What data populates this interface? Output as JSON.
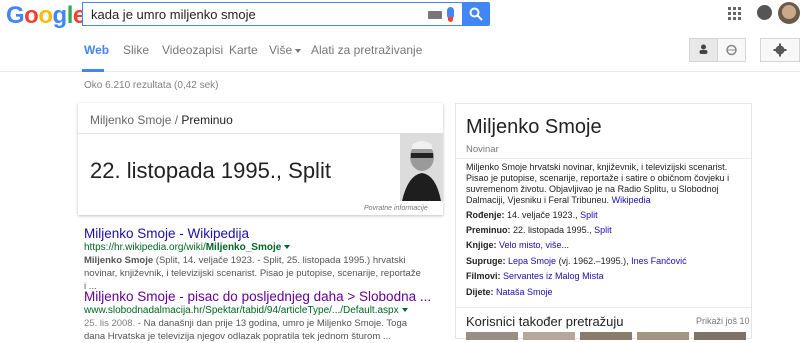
{
  "header": {
    "logo": [
      "G",
      "o",
      "o",
      "g",
      "l",
      "e"
    ],
    "logo_colors": [
      "#4285f4",
      "#ea4335",
      "#fbbc05",
      "#4285f4",
      "#34a853",
      "#ea4335"
    ],
    "query": "kada je umro miljenko smoje"
  },
  "tabs": [
    {
      "label": "Web",
      "active": true
    },
    {
      "label": "Slike"
    },
    {
      "label": "Videozapisi"
    },
    {
      "label": "Karte"
    },
    {
      "label": "Više"
    },
    {
      "label": "Alati za pretraživanje"
    }
  ],
  "stats": "Oko 6.210 rezultata (0,42 sek)",
  "answer": {
    "entity": "Miljenko Smoje",
    "separator": "/",
    "attribute": "Preminuo",
    "value": "22. listopada 1995., Split",
    "feedback": "Povratne informacije"
  },
  "results": [
    {
      "title": "Miljenko Smoje - Wikipedija",
      "url_prefix": "https://hr.wikipedia.org/wiki/",
      "url_bold": "Miljenko_Smoje",
      "snippet_bold": "Miljenko Smoje",
      "snippet": " (Split, 14. veljače 1923. - Split, 25. listopada 1995.) hrvatski novinar, književnik, i televizijski scenarist. Pisao je putopise, scenarije, reportaže i ..."
    },
    {
      "title": "Miljenko Smoje - pisac do posljednjeg daha > Slobodna ...",
      "url": "www.slobodnadalmacija.hr/Spektar/tabid/94/articleType/.../Default.aspx",
      "date": "25. lis 2008.",
      "snippet": " - Na današnji dan prije 13 godina, umro je Miljenko Smoje. Toga dana Hrvatska je televizija njegov odlazak popratila tek jednom šturom ..."
    }
  ],
  "knowledge_panel": {
    "title": "Miljenko Smoje",
    "subtitle": "Novinar",
    "description": "Miljenko Smoje hrvatski novinar, književnik, i televizijski scenarist. Pisao je putopise, scenarije, reportaže i satire o običnom čovjeku i suvremenom životu. Objavljivao je na Radio Splitu, u Slobodnoj Dalmaciji, Vjesniku i Feral Tribuneu.",
    "desc_link": "Wikipedia",
    "facts": [
      {
        "label": "Rođenje:",
        "text": " 14. veljače 1923., ",
        "link": "Split"
      },
      {
        "label": "Preminuo:",
        "text": " 22. listopada 1995., ",
        "link": "Split"
      },
      {
        "label": "Knjige:",
        "text": " ",
        "link": "Velo misto, više..."
      },
      {
        "label": "Supruge:",
        "text": " ",
        "link": "Lepa Smoje",
        "extra": " (vj. 1962.–1995.), ",
        "link2": "Ines Fančović"
      },
      {
        "label": "Filmovi:",
        "text": " ",
        "link": "Servantes iz Malog Mista"
      },
      {
        "label": "Dijete:",
        "text": " ",
        "link": "Nataša Smoje"
      }
    ],
    "also_searched": "Korisnici također pretražuju",
    "show_more": "Prikaži još 10"
  }
}
